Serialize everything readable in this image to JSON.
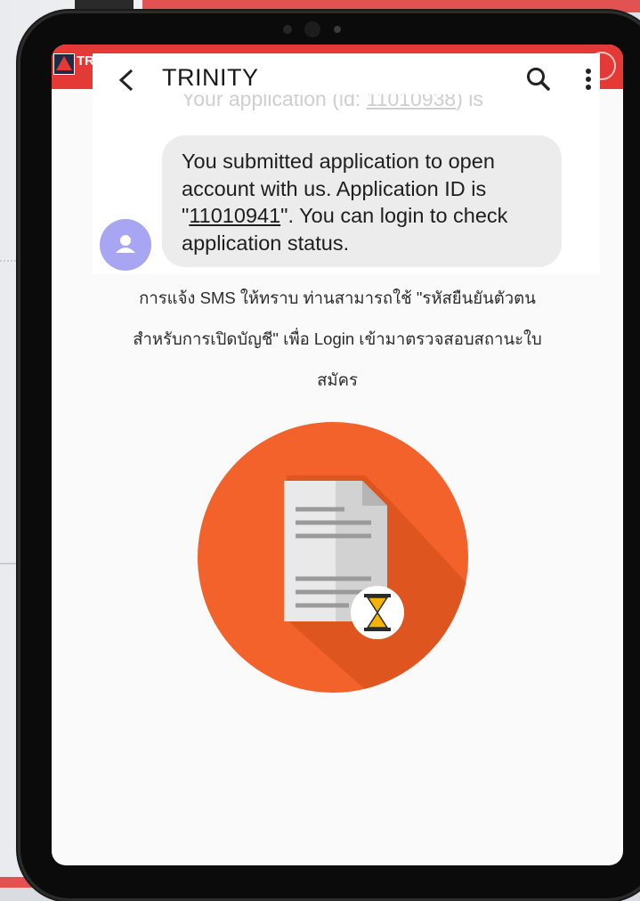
{
  "site": {
    "logo_text": "TR"
  },
  "sms": {
    "title": "TRINITY",
    "ghost_prefix": "Your application (id: ",
    "ghost_id": "11010938",
    "ghost_suffix": ") is",
    "message_part1": "You submitted application to open account with us. Application ID is \"",
    "application_id": "11010941",
    "message_part2": "\". You can login to check application status."
  },
  "caption": {
    "line1": "การแจ้ง SMS ให้ทราบ ท่านสามารถใช้ \"รหัสยืนยันตัวตน",
    "line2": "สำหรับการเปิดบัญชี\" เพื่อ Login เข้ามาตรวจสอบสถานะใบ",
    "line3": "สมัคร"
  },
  "colors": {
    "brand_red": "#e53935",
    "illustration_orange": "#f4622c",
    "avatar_purple": "#a8a5f3"
  },
  "icons": {
    "back": "chevron-left-icon",
    "search": "search-icon",
    "more": "more-vertical-icon",
    "avatar": "person-icon",
    "illustration": "document-pending-icon",
    "hourglass": "hourglass-icon"
  }
}
